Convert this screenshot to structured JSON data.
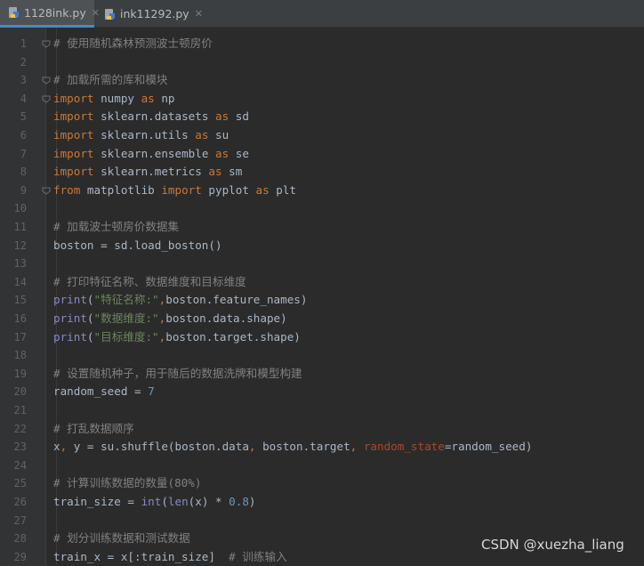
{
  "tabs": [
    {
      "label": "1128ink.py",
      "active": true,
      "icon": "python-file-icon"
    },
    {
      "label": "ink11292.py",
      "active": false,
      "icon": "python-file-icon"
    }
  ],
  "colors": {
    "background": "#2b2b2b",
    "keyword": "#cc7832",
    "name": "#a9b7c6",
    "comment": "#808080",
    "builtin": "#8888c6",
    "string": "#6a8759",
    "number": "#6897bb",
    "param": "#aa4926"
  },
  "lines": [
    {
      "n": "1",
      "fold": true,
      "tokens": [
        [
          "cm",
          "# 使用随机森林预测波士顿房价"
        ]
      ]
    },
    {
      "n": "2",
      "tokens": []
    },
    {
      "n": "3",
      "fold": true,
      "tokens": [
        [
          "cm",
          "# 加载所需的库和模块"
        ]
      ]
    },
    {
      "n": "4",
      "fold": true,
      "tokens": [
        [
          "kw",
          "import"
        ],
        [
          "nm",
          " numpy "
        ],
        [
          "kw",
          "as"
        ],
        [
          "nm",
          " np"
        ]
      ]
    },
    {
      "n": "5",
      "tokens": [
        [
          "kw",
          "import"
        ],
        [
          "nm",
          " sklearn.datasets "
        ],
        [
          "kw",
          "as"
        ],
        [
          "nm",
          " sd"
        ]
      ]
    },
    {
      "n": "6",
      "tokens": [
        [
          "kw",
          "import"
        ],
        [
          "nm",
          " sklearn.utils "
        ],
        [
          "kw",
          "as"
        ],
        [
          "nm",
          " su"
        ]
      ]
    },
    {
      "n": "7",
      "tokens": [
        [
          "kw",
          "import"
        ],
        [
          "nm",
          " sklearn.ensemble "
        ],
        [
          "kw",
          "as"
        ],
        [
          "nm",
          " se"
        ]
      ]
    },
    {
      "n": "8",
      "tokens": [
        [
          "kw",
          "import"
        ],
        [
          "nm",
          " sklearn.metrics "
        ],
        [
          "kw",
          "as"
        ],
        [
          "nm",
          " sm"
        ]
      ]
    },
    {
      "n": "9",
      "fold": true,
      "tokens": [
        [
          "kw",
          "from"
        ],
        [
          "nm",
          " matplotlib "
        ],
        [
          "kw",
          "import"
        ],
        [
          "nm",
          " pyplot "
        ],
        [
          "kw",
          "as"
        ],
        [
          "nm",
          " plt"
        ]
      ]
    },
    {
      "n": "10",
      "tokens": []
    },
    {
      "n": "11",
      "tokens": [
        [
          "cm",
          "# 加载波士顿房价数据集"
        ]
      ]
    },
    {
      "n": "12",
      "tokens": [
        [
          "nm",
          "boston = sd.load_boston()"
        ]
      ]
    },
    {
      "n": "13",
      "tokens": []
    },
    {
      "n": "14",
      "tokens": [
        [
          "cm",
          "# 打印特征名称、数据维度和目标维度"
        ]
      ]
    },
    {
      "n": "15",
      "tokens": [
        [
          "bi",
          "print"
        ],
        [
          "nm",
          "("
        ],
        [
          "st",
          "\"特征名称:\""
        ],
        [
          "kw",
          ","
        ],
        [
          "nm",
          "boston.feature_names)"
        ]
      ]
    },
    {
      "n": "16",
      "tokens": [
        [
          "bi",
          "print"
        ],
        [
          "nm",
          "("
        ],
        [
          "st",
          "\"数据维度:\""
        ],
        [
          "kw",
          ","
        ],
        [
          "nm",
          "boston.data.shape)"
        ]
      ]
    },
    {
      "n": "17",
      "tokens": [
        [
          "bi",
          "print"
        ],
        [
          "nm",
          "("
        ],
        [
          "st",
          "\"目标维度:\""
        ],
        [
          "kw",
          ","
        ],
        [
          "nm",
          "boston.target.shape)"
        ]
      ]
    },
    {
      "n": "18",
      "tokens": []
    },
    {
      "n": "19",
      "tokens": [
        [
          "cm",
          "# 设置随机种子，用于随后的数据洗牌和模型构建"
        ]
      ]
    },
    {
      "n": "20",
      "tokens": [
        [
          "nm",
          "random_seed = "
        ],
        [
          "nu",
          "7"
        ]
      ]
    },
    {
      "n": "21",
      "tokens": []
    },
    {
      "n": "22",
      "tokens": [
        [
          "cm",
          "# 打乱数据顺序"
        ]
      ]
    },
    {
      "n": "23",
      "tokens": [
        [
          "nm",
          "x"
        ],
        [
          "kw",
          ","
        ],
        [
          "nm",
          " y = su.shuffle(boston.data"
        ],
        [
          "kw",
          ","
        ],
        [
          "nm",
          " boston.target"
        ],
        [
          "kw",
          ","
        ],
        [
          "nm",
          " "
        ],
        [
          "pa",
          "random_state"
        ],
        [
          "nm",
          "=random_seed)"
        ]
      ]
    },
    {
      "n": "24",
      "tokens": []
    },
    {
      "n": "25",
      "tokens": [
        [
          "cm",
          "# 计算训练数据的数量(80%)"
        ]
      ]
    },
    {
      "n": "26",
      "tokens": [
        [
          "nm",
          "train_size = "
        ],
        [
          "bi",
          "int"
        ],
        [
          "nm",
          "("
        ],
        [
          "bi",
          "len"
        ],
        [
          "nm",
          "(x) * "
        ],
        [
          "nu",
          "0.8"
        ],
        [
          "nm",
          ")"
        ]
      ]
    },
    {
      "n": "27",
      "tokens": []
    },
    {
      "n": "28",
      "tokens": [
        [
          "cm",
          "# 划分训练数据和测试数据"
        ]
      ]
    },
    {
      "n": "29",
      "tokens": [
        [
          "nm",
          "train_x = x[:train_size]  "
        ],
        [
          "cm",
          "# 训练输入"
        ]
      ]
    }
  ],
  "watermark": "CSDN @xuezha_liang"
}
